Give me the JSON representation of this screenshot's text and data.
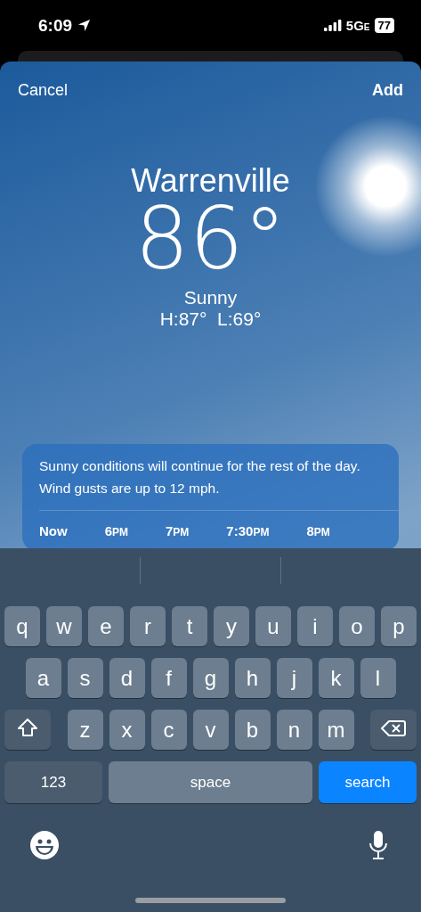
{
  "status_bar": {
    "time": "6:09",
    "network": "5G",
    "network_suffix": "E",
    "battery": "77"
  },
  "sheet": {
    "cancel": "Cancel",
    "add": "Add",
    "city": "Warrenville",
    "temperature": "86°",
    "condition": "Sunny",
    "high_low": "H:87°  L:69°"
  },
  "forecast": {
    "summary": "Sunny conditions will continue for the rest of the day. Wind gusts are up to 12 mph.",
    "hours": [
      {
        "time": "Now"
      },
      {
        "time": "6",
        "suffix": "PM"
      },
      {
        "time": "7",
        "suffix": "PM"
      },
      {
        "time": "7:30",
        "suffix": "PM"
      },
      {
        "time": "8",
        "suffix": "PM"
      }
    ]
  },
  "keyboard": {
    "rows": [
      [
        "q",
        "w",
        "e",
        "r",
        "t",
        "y",
        "u",
        "i",
        "o",
        "p"
      ],
      [
        "a",
        "s",
        "d",
        "f",
        "g",
        "h",
        "j",
        "k",
        "l"
      ],
      [
        "z",
        "x",
        "c",
        "v",
        "b",
        "n",
        "m"
      ]
    ],
    "numbers_key": "123",
    "space_key": "space",
    "search_key": "search"
  }
}
